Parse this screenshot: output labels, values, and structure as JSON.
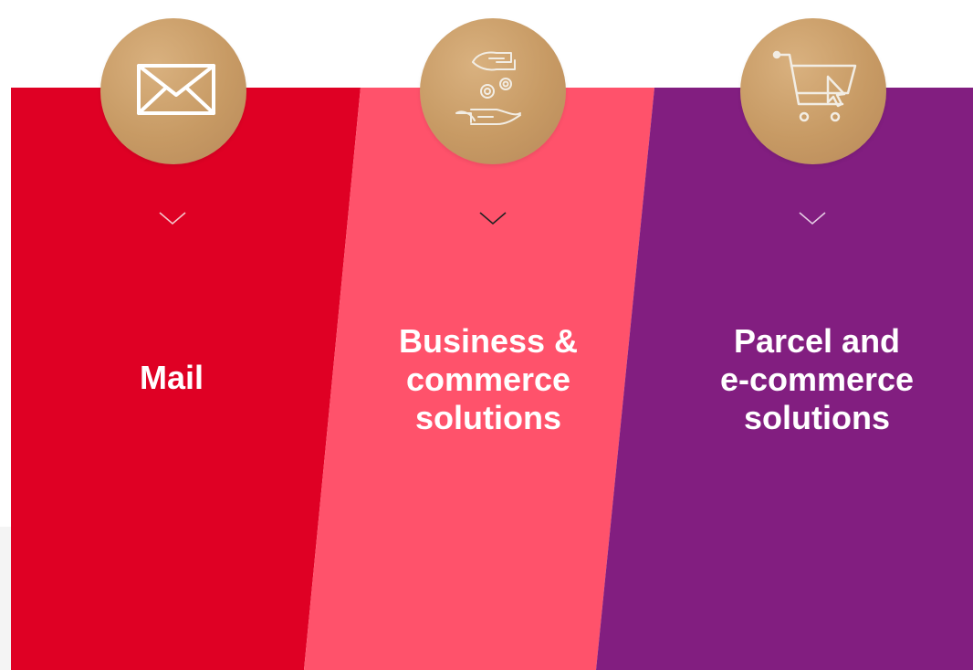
{
  "colors": {
    "mail": "#df0024",
    "business": "#ff526b",
    "parcel": "#821e80",
    "kraft": "#c79a64"
  },
  "panels": [
    {
      "id": "mail",
      "title_lines": [
        "Mail"
      ],
      "icon": "envelope-icon"
    },
    {
      "id": "business",
      "title_lines": [
        "Business &",
        "commerce",
        "solutions"
      ],
      "icon": "hands-gears-icon"
    },
    {
      "id": "parcel",
      "title_lines": [
        "Parcel and",
        "e-commerce",
        "solutions"
      ],
      "icon": "shopping-cart-icon"
    }
  ]
}
